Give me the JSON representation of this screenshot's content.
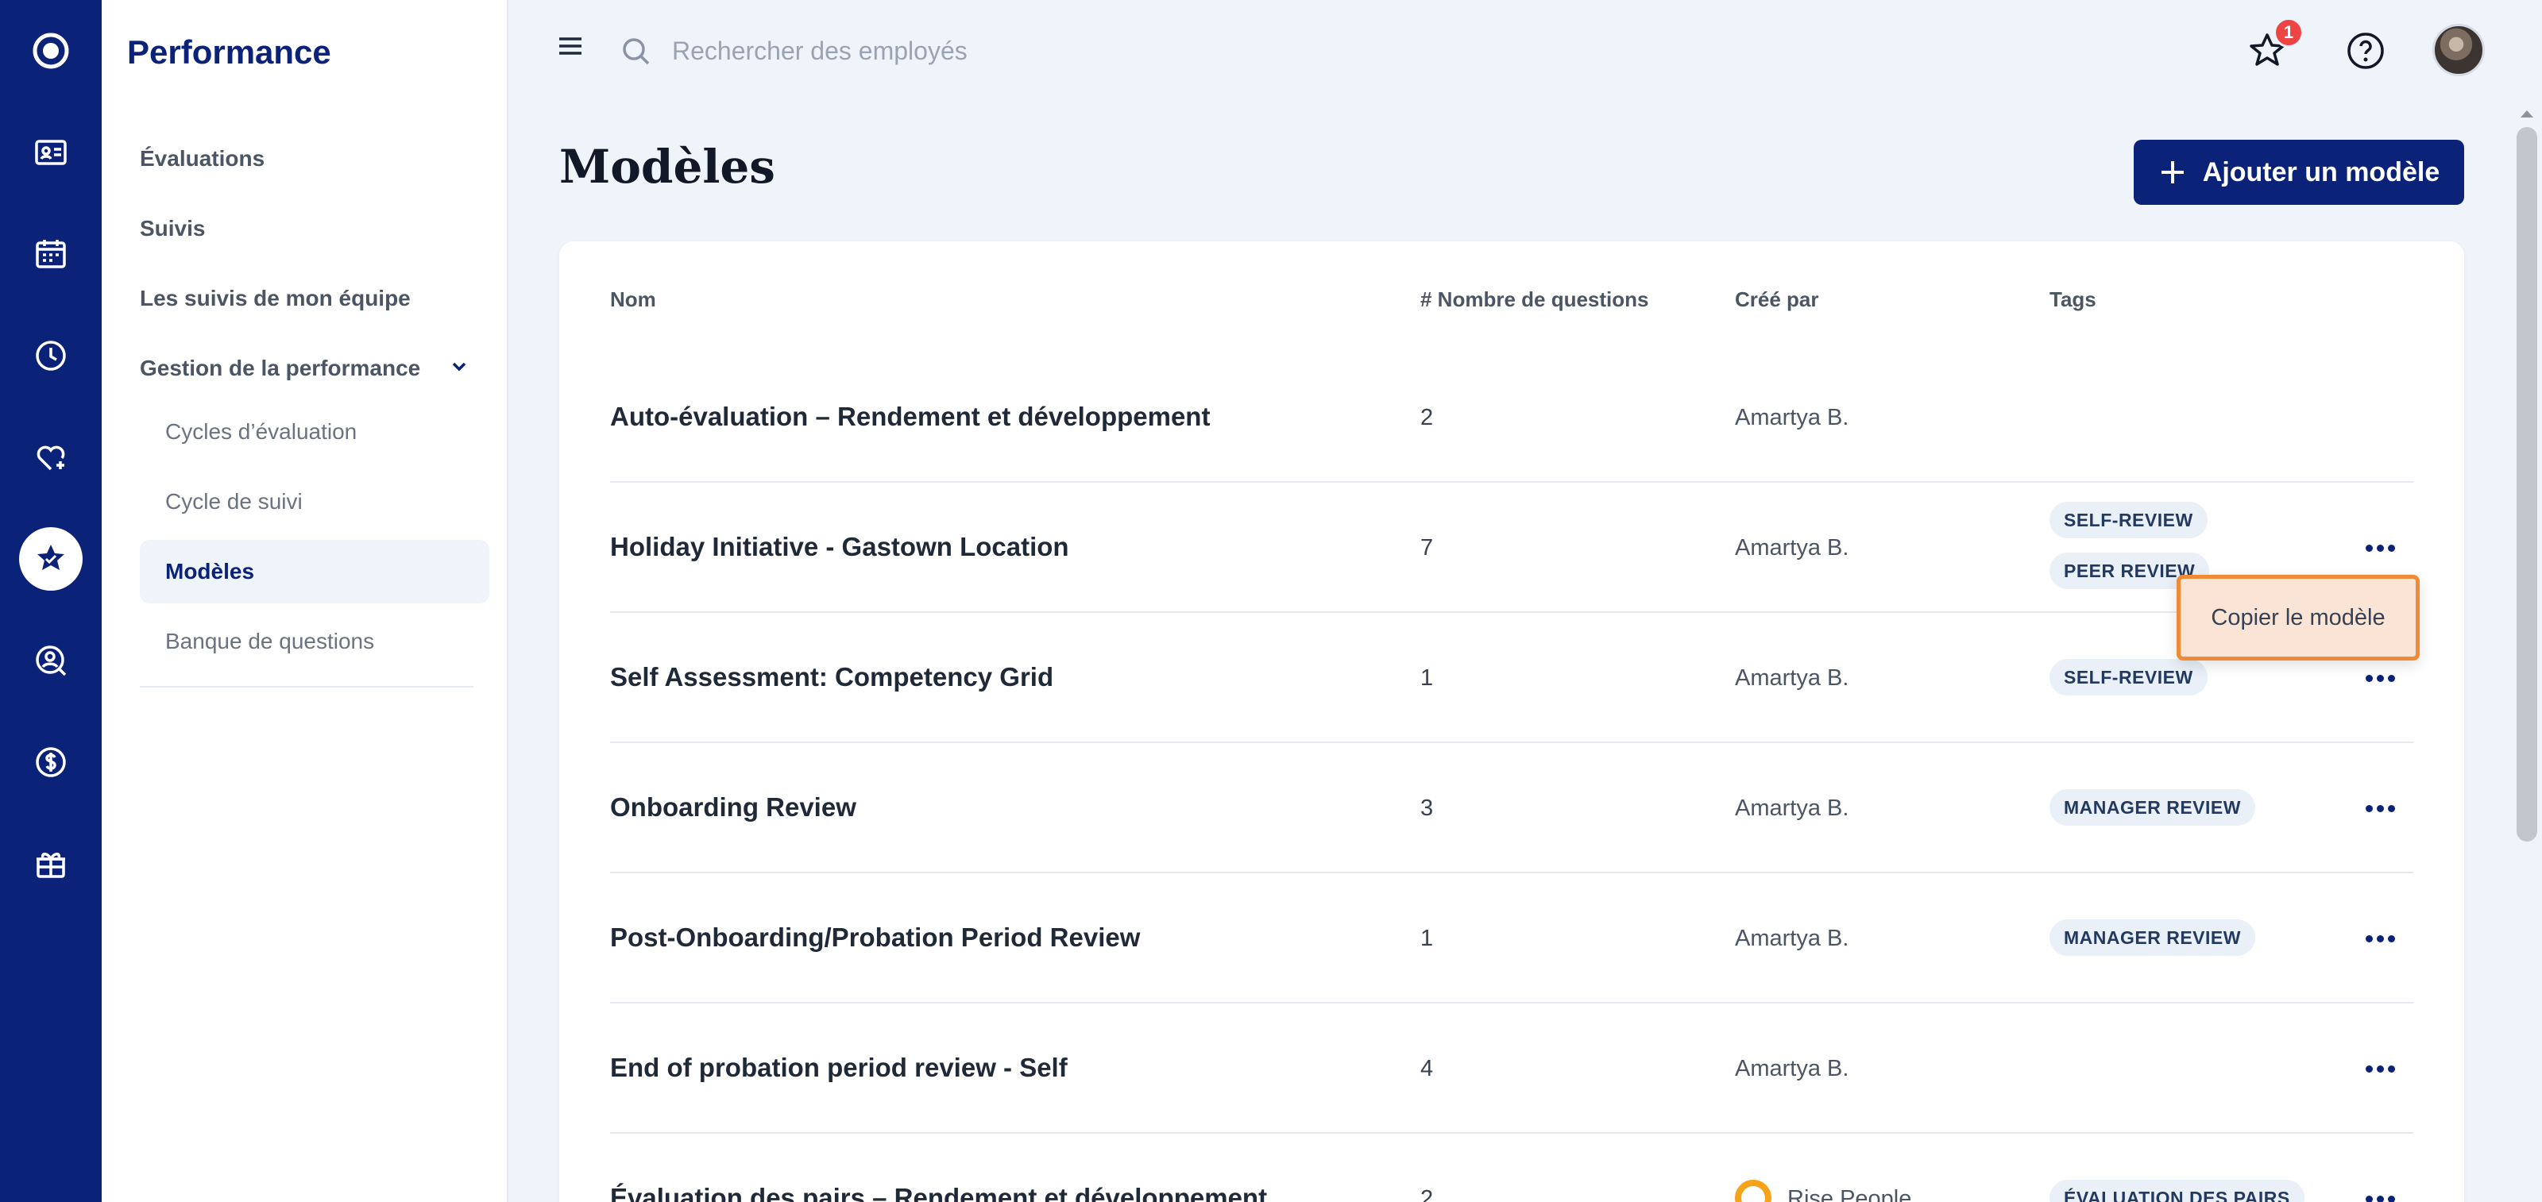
{
  "app": {
    "section_title": "Performance"
  },
  "rail": {
    "icons": [
      "app-logo-icon",
      "id-card-icon",
      "calendar-icon",
      "clock-icon",
      "heart-plus-icon",
      "star-badge-icon",
      "person-search-icon",
      "dollar-icon",
      "gift-icon"
    ],
    "active": "star-badge-icon"
  },
  "sidebar": {
    "items": [
      {
        "label": "Évaluations"
      },
      {
        "label": "Suivis"
      },
      {
        "label": "Les suivis de mon équipe"
      },
      {
        "label": "Gestion de la performance"
      }
    ],
    "subitems": [
      {
        "label": "Cycles d’évaluation"
      },
      {
        "label": "Cycle de suivi"
      },
      {
        "label": "Modèles"
      },
      {
        "label": "Banque de questions"
      }
    ],
    "selected": "Modèles"
  },
  "topbar": {
    "search_placeholder": "Rechercher des employés",
    "notification_count": "1"
  },
  "header": {
    "title": "Modèles",
    "add_button": "Ajouter un modèle"
  },
  "table": {
    "columns": {
      "name": "Nom",
      "questions": "# Nombre de questions",
      "created_by": "Créé par",
      "tags": "Tags"
    },
    "rows": [
      {
        "name": "Auto-évaluation – Rendement et développement",
        "questions": "2",
        "created_by": "Amartya B.",
        "tags": []
      },
      {
        "name": "Holiday Initiative - Gastown Location",
        "questions": "7",
        "created_by": "Amartya B.",
        "tags": [
          "SELF-REVIEW",
          "PEER REVIEW"
        ]
      },
      {
        "name": "Self Assessment: Competency Grid",
        "questions": "1",
        "created_by": "Amartya B.",
        "tags": [
          "SELF-REVIEW"
        ]
      },
      {
        "name": "Onboarding Review",
        "questions": "3",
        "created_by": "Amartya B.",
        "tags": [
          "MANAGER REVIEW"
        ]
      },
      {
        "name": "Post-Onboarding/Probation Period Review",
        "questions": "1",
        "created_by": "Amartya B.",
        "tags": [
          "MANAGER REVIEW"
        ]
      },
      {
        "name": "End of probation period review - Self",
        "questions": "4",
        "created_by": "Amartya B.",
        "tags": []
      },
      {
        "name": "Évaluation des pairs – Rendement et développement",
        "questions": "2",
        "created_by": "Rise People",
        "tags": [
          "ÉVALUATION DES PAIRS"
        ]
      }
    ]
  },
  "context_menu": {
    "copy_label": "Copier le modèle"
  },
  "colors": {
    "brand": "#0b2279",
    "page_bg": "#eff3fa",
    "menu_highlight": "#ef8a36",
    "badge": "#ef4444",
    "tag_bg": "#e9f0f8"
  }
}
